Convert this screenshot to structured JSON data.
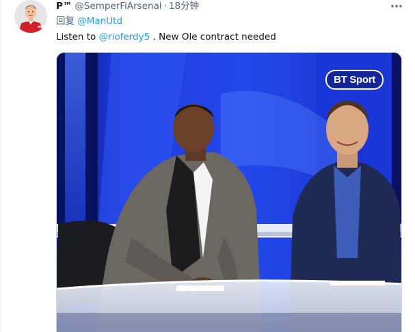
{
  "tweet": {
    "display_name": "P™",
    "handle": "@SemperFiArsenal",
    "separator": "·",
    "time": "18分钟",
    "reply_prefix": "回复",
    "reply_to": "@ManUtd",
    "text_before": "Listen to ",
    "text_mention": "@rioferdy5",
    "text_after": " . New Ole contract needed",
    "avatar_badge": "AFC"
  },
  "media": {
    "watermark": "BT Sport"
  },
  "icons": {
    "more": "more-horizontal-icon"
  },
  "colors": {
    "link": "#1d9bf0",
    "secondary_text": "#536471",
    "primary_text": "#0f1419",
    "studio_blue": "#1a2fd0"
  }
}
